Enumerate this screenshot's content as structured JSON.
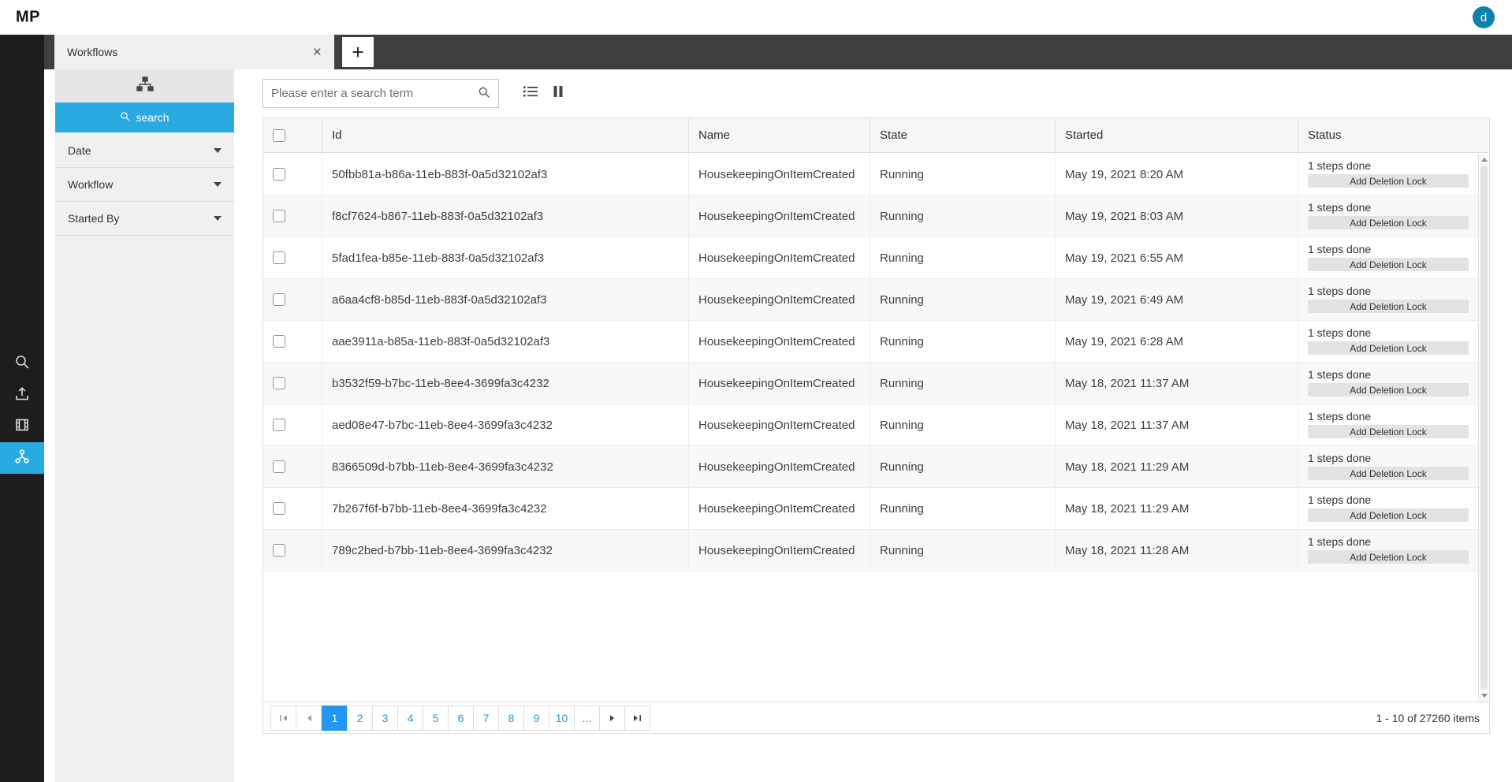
{
  "app": {
    "logo": "MP",
    "avatar_initial": "d"
  },
  "tabs": {
    "items": [
      {
        "label": "Workflows",
        "active": true
      }
    ],
    "new_tab_label": "+",
    "close_glyph": "×"
  },
  "sidebar": {
    "icons": [
      {
        "name": "search-icon",
        "active": false
      },
      {
        "name": "upload-icon",
        "active": false
      },
      {
        "name": "film-icon",
        "active": false
      },
      {
        "name": "workflow-icon",
        "active": true
      }
    ]
  },
  "filter_panel": {
    "header_icon": "hierarchy-icon",
    "search_button_label": "search",
    "sections": [
      {
        "label": "Date"
      },
      {
        "label": "Workflow"
      },
      {
        "label": "Started By"
      }
    ]
  },
  "toolbar": {
    "search_placeholder": "Please enter a search term",
    "icons": [
      "search-icon",
      "list-view-icon",
      "pause-icon"
    ]
  },
  "table": {
    "columns": [
      "Id",
      "Name",
      "State",
      "Started",
      "Status"
    ],
    "rows": [
      {
        "id": "50fbb81a-b86a-11eb-883f-0a5d32102af3",
        "name": "HousekeepingOnItemCreated",
        "state": "Running",
        "started": "May 19, 2021 8:20 AM",
        "steps": "1 steps done",
        "action": "Add Deletion Lock"
      },
      {
        "id": "f8cf7624-b867-11eb-883f-0a5d32102af3",
        "name": "HousekeepingOnItemCreated",
        "state": "Running",
        "started": "May 19, 2021 8:03 AM",
        "steps": "1 steps done",
        "action": "Add Deletion Lock"
      },
      {
        "id": "5fad1fea-b85e-11eb-883f-0a5d32102af3",
        "name": "HousekeepingOnItemCreated",
        "state": "Running",
        "started": "May 19, 2021 6:55 AM",
        "steps": "1 steps done",
        "action": "Add Deletion Lock"
      },
      {
        "id": "a6aa4cf8-b85d-11eb-883f-0a5d32102af3",
        "name": "HousekeepingOnItemCreated",
        "state": "Running",
        "started": "May 19, 2021 6:49 AM",
        "steps": "1 steps done",
        "action": "Add Deletion Lock"
      },
      {
        "id": "aae3911a-b85a-11eb-883f-0a5d32102af3",
        "name": "HousekeepingOnItemCreated",
        "state": "Running",
        "started": "May 19, 2021 6:28 AM",
        "steps": "1 steps done",
        "action": "Add Deletion Lock"
      },
      {
        "id": "b3532f59-b7bc-11eb-8ee4-3699fa3c4232",
        "name": "HousekeepingOnItemCreated",
        "state": "Running",
        "started": "May 18, 2021 11:37 AM",
        "steps": "1 steps done",
        "action": "Add Deletion Lock"
      },
      {
        "id": "aed08e47-b7bc-11eb-8ee4-3699fa3c4232",
        "name": "HousekeepingOnItemCreated",
        "state": "Running",
        "started": "May 18, 2021 11:37 AM",
        "steps": "1 steps done",
        "action": "Add Deletion Lock"
      },
      {
        "id": "8366509d-b7bb-11eb-8ee4-3699fa3c4232",
        "name": "HousekeepingOnItemCreated",
        "state": "Running",
        "started": "May 18, 2021 11:29 AM",
        "steps": "1 steps done",
        "action": "Add Deletion Lock"
      },
      {
        "id": "7b267f6f-b7bb-11eb-8ee4-3699fa3c4232",
        "name": "HousekeepingOnItemCreated",
        "state": "Running",
        "started": "May 18, 2021 11:29 AM",
        "steps": "1 steps done",
        "action": "Add Deletion Lock"
      },
      {
        "id": "789c2bed-b7bb-11eb-8ee4-3699fa3c4232",
        "name": "HousekeepingOnItemCreated",
        "state": "Running",
        "started": "May 18, 2021 11:28 AM",
        "steps": "1 steps done",
        "action": "Add Deletion Lock"
      }
    ]
  },
  "pagination": {
    "pages": [
      "1",
      "2",
      "3",
      "4",
      "5",
      "6",
      "7",
      "8",
      "9",
      "10"
    ],
    "ellipsis": "...",
    "active_page": "1",
    "summary": "1 - 10 of 27260 items"
  },
  "colors": {
    "accent_blue": "#29abe2",
    "pager_active_blue": "#2196f3",
    "sidebar_bg": "#1d1d1d",
    "tabbar_bg": "#3f3f3f",
    "panel_bg": "#f0f0f0",
    "avatar_teal": "#0e81ad"
  }
}
